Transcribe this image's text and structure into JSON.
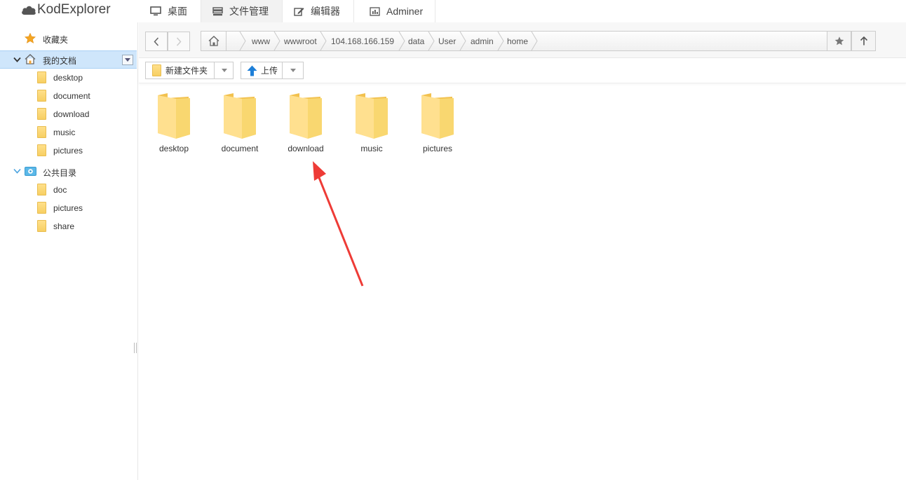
{
  "app": {
    "logo_text": "KodExplorer"
  },
  "nav": {
    "tabs": [
      {
        "label": "桌面",
        "icon": "monitor-icon"
      },
      {
        "label": "文件管理",
        "icon": "file-manager-icon",
        "active": true
      },
      {
        "label": "编辑器",
        "icon": "edit-icon"
      },
      {
        "label": "Adminer",
        "icon": "chart-icon"
      }
    ]
  },
  "sidebar": {
    "favorites": "收藏夹",
    "my_docs": "我的文档",
    "my_docs_children": [
      "desktop",
      "document",
      "download",
      "music",
      "pictures"
    ],
    "public": "公共目录",
    "public_children": [
      "doc",
      "pictures",
      "share"
    ]
  },
  "address": {
    "crumbs": [
      "www",
      "wwwroot",
      "104.168.166.159",
      "data",
      "User",
      "admin",
      "home"
    ]
  },
  "toolbar": {
    "new_folder": "新建文件夹",
    "upload": "上传"
  },
  "files": [
    "desktop",
    "document",
    "download",
    "music",
    "pictures"
  ],
  "colors": {
    "folder": "#f7cf63",
    "selected_row": "#cfe6fb",
    "annotation_arrow": "#ee3b36",
    "upload_arrow": "#1e7fd8"
  }
}
